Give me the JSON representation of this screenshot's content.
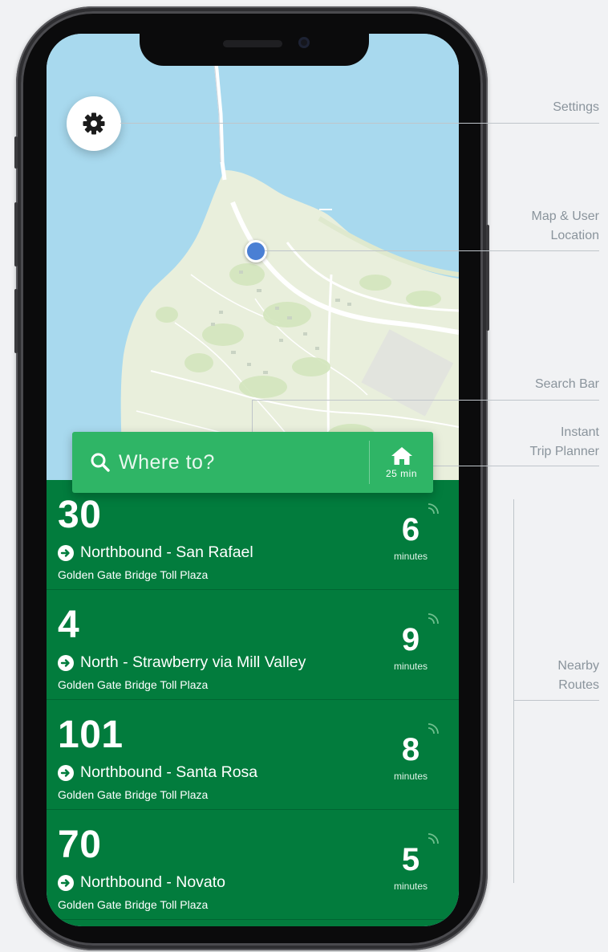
{
  "annotations": {
    "settings": "Settings",
    "map_user_location_line1": "Map & User",
    "map_user_location_line2": "Location",
    "search_bar": "Search Bar",
    "instant_trip_planner_line1": "Instant",
    "instant_trip_planner_line2": "Trip Planner",
    "nearby_routes_line1": "Nearby",
    "nearby_routes_line2": "Routes"
  },
  "search": {
    "placeholder": "Where to?",
    "home_time": "25 min"
  },
  "routes": [
    {
      "number": "30",
      "direction": "Northbound - San Rafael",
      "stop": "Golden Gate Bridge Toll Plaza",
      "eta": "6",
      "eta_unit": "minutes"
    },
    {
      "number": "4",
      "direction": "North - Strawberry via Mill Valley",
      "stop": "Golden Gate Bridge Toll Plaza",
      "eta": "9",
      "eta_unit": "minutes"
    },
    {
      "number": "101",
      "direction": "Northbound - Santa Rosa",
      "stop": "Golden Gate Bridge Toll Plaza",
      "eta": "8",
      "eta_unit": "minutes"
    },
    {
      "number": "70",
      "direction": "Northbound - Novato",
      "stop": "Golden Gate Bridge Toll Plaza",
      "eta": "5",
      "eta_unit": "minutes"
    }
  ],
  "colors": {
    "brand_green": "#2fb566",
    "routes_background": "#027c3d",
    "water": "#a8d9ee",
    "land": "#e9efdc",
    "user_location": "#4a7fd4"
  },
  "icons": [
    "gear-icon",
    "search-icon",
    "home-icon",
    "arrow-right-circle-icon",
    "realtime-signal-icon"
  ]
}
